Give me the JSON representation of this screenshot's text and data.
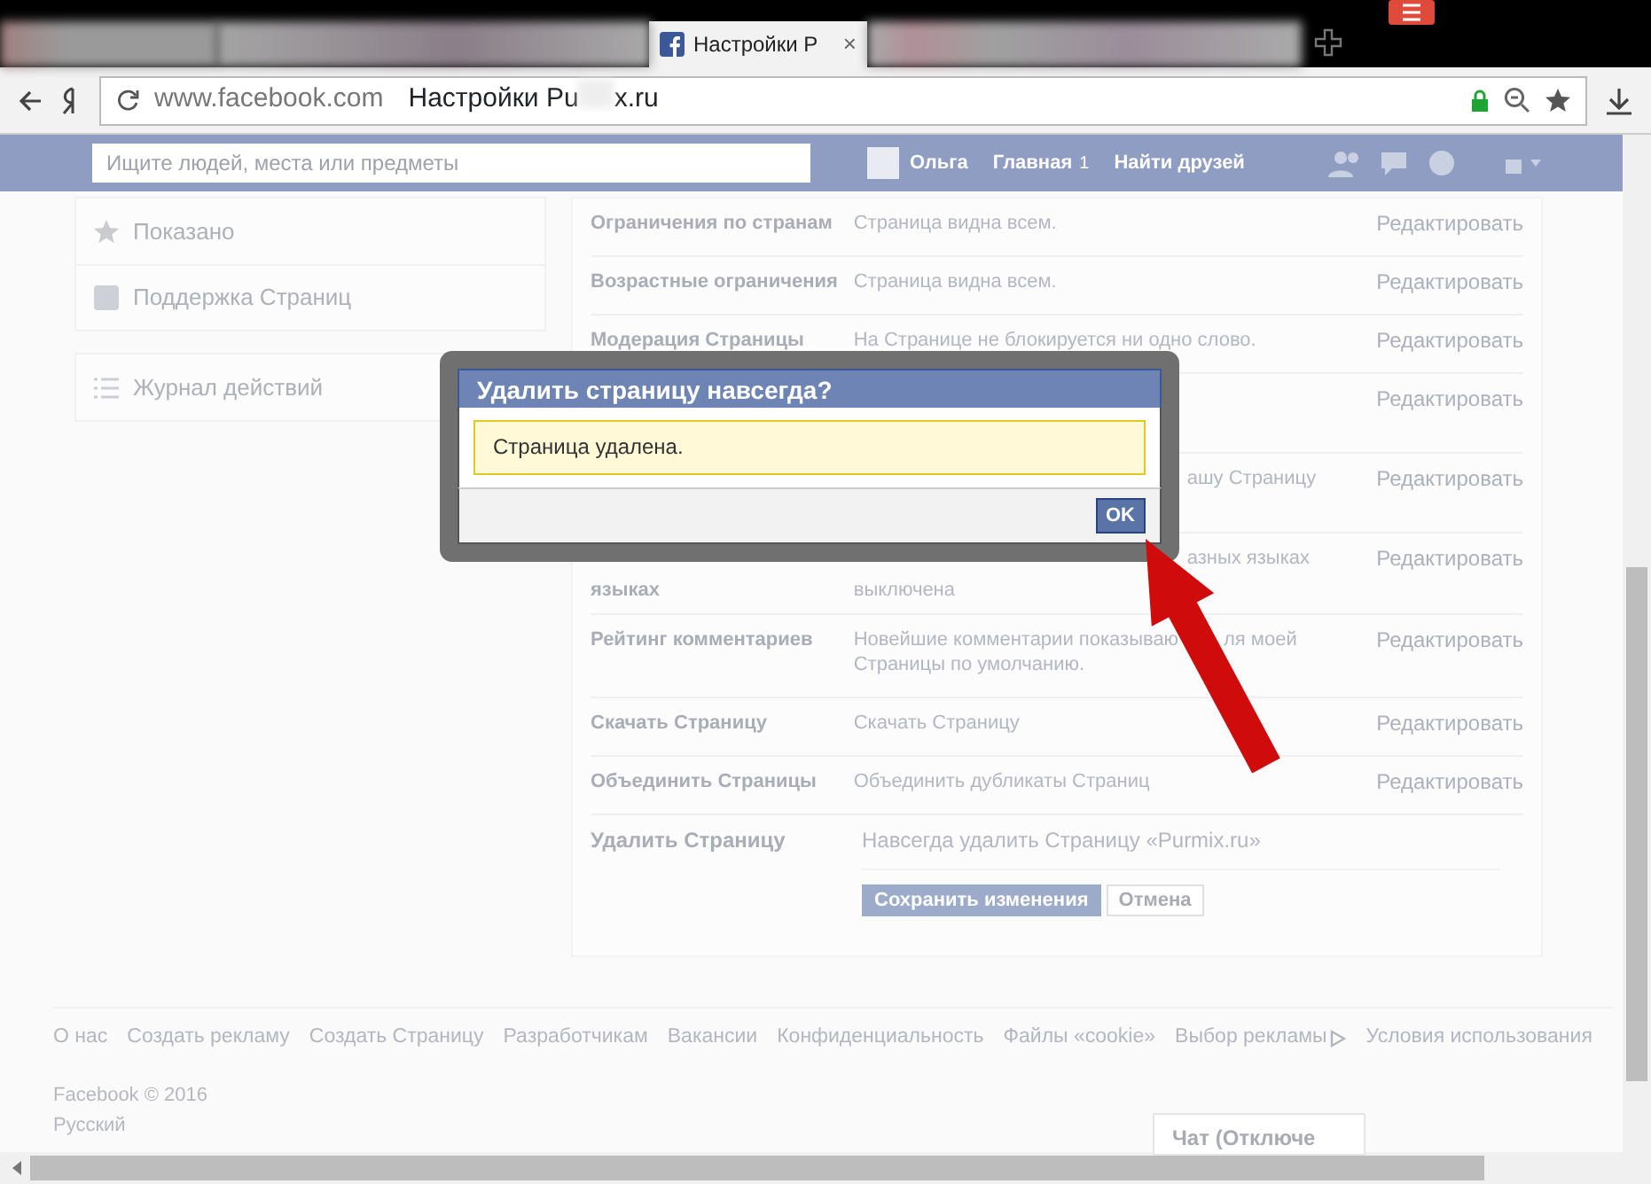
{
  "browser": {
    "tabs": [
      {
        "kind": "blurred",
        "selected": false
      },
      {
        "kind": "blurred",
        "selected": false
      },
      {
        "kind": "page",
        "label": "Настройки Р",
        "close": "×",
        "selected": true
      },
      {
        "kind": "blurred",
        "selected": false
      }
    ],
    "address": {
      "domain": "www.facebook.com",
      "title_start": "Настройки Pu",
      "title_end": "x.ru"
    }
  },
  "topbar": {
    "search": {
      "placeholder": "Ищите людей, места или предметы"
    },
    "user": "Ольга",
    "home": "Главная",
    "home_count": "1",
    "find_friends": "Найти друзей"
  },
  "sidebar": {
    "groups": [
      [
        {
          "kind": "star",
          "label": "Показано"
        },
        {
          "kind": "fb",
          "label": "Поддержка Страниц"
        }
      ],
      [
        {
          "kind": "list",
          "label": "Журнал действий"
        }
      ]
    ]
  },
  "settings": {
    "rows": [
      {
        "kind": "full",
        "label": "Ограничения по странам",
        "value": "Страница видна всем.",
        "action": "Редактировать"
      },
      {
        "kind": "full",
        "label": "Возрастные ограничения",
        "value": "Страница видна всем.",
        "action": "Редактировать"
      },
      {
        "kind": "full",
        "label": "Модерация Страницы",
        "value": "На Странице не блокируется ни одно слово.",
        "action": "Редактировать"
      },
      {
        "kind": "covered",
        "action": "Редактировать"
      },
      {
        "kind": "covered",
        "value": "ашу Страницу",
        "action": "Редактировать"
      },
      {
        "kind": "covered",
        "label": "языках",
        "value": "азных языках",
        "value_2": "выключена",
        "action": "Редактировать"
      },
      {
        "kind": "split",
        "label": "Рейтинг комментариев",
        "value": "Новейшие комментарии показываю",
        "value_end": "ля моей",
        "value_2": "Страницы по умолчанию.",
        "action": "Редактировать"
      },
      {
        "kind": "full",
        "label": "Скачать Страницу",
        "value": "Скачать Страницу",
        "action": "Редактировать"
      },
      {
        "kind": "full",
        "label": "Объединить Страницы",
        "value": "Объединить дубликаты Страниц",
        "action": "Редактировать"
      }
    ],
    "delete": {
      "label": "Удалить Страницу",
      "value": "Навсегда удалить Страницу «Purmix.ru»",
      "save": "Сохранить изменения",
      "cancel": "Отмена"
    }
  },
  "footer": {
    "links": [
      "О нас",
      "Создать рекламу",
      "Создать Страницу",
      "Разработчикам",
      "Вакансии",
      "Конфиденциальность",
      "Файлы «cookie»",
      "Выбор рекламы",
      "Условия использования"
    ],
    "copyright": "Facebook © 2016",
    "language": "Русский"
  },
  "chat": {
    "label": "Чат (Отключе"
  },
  "dialog": {
    "title": "Удалить страницу навсегда?",
    "message": "Страница удалена.",
    "ok": "OK"
  }
}
